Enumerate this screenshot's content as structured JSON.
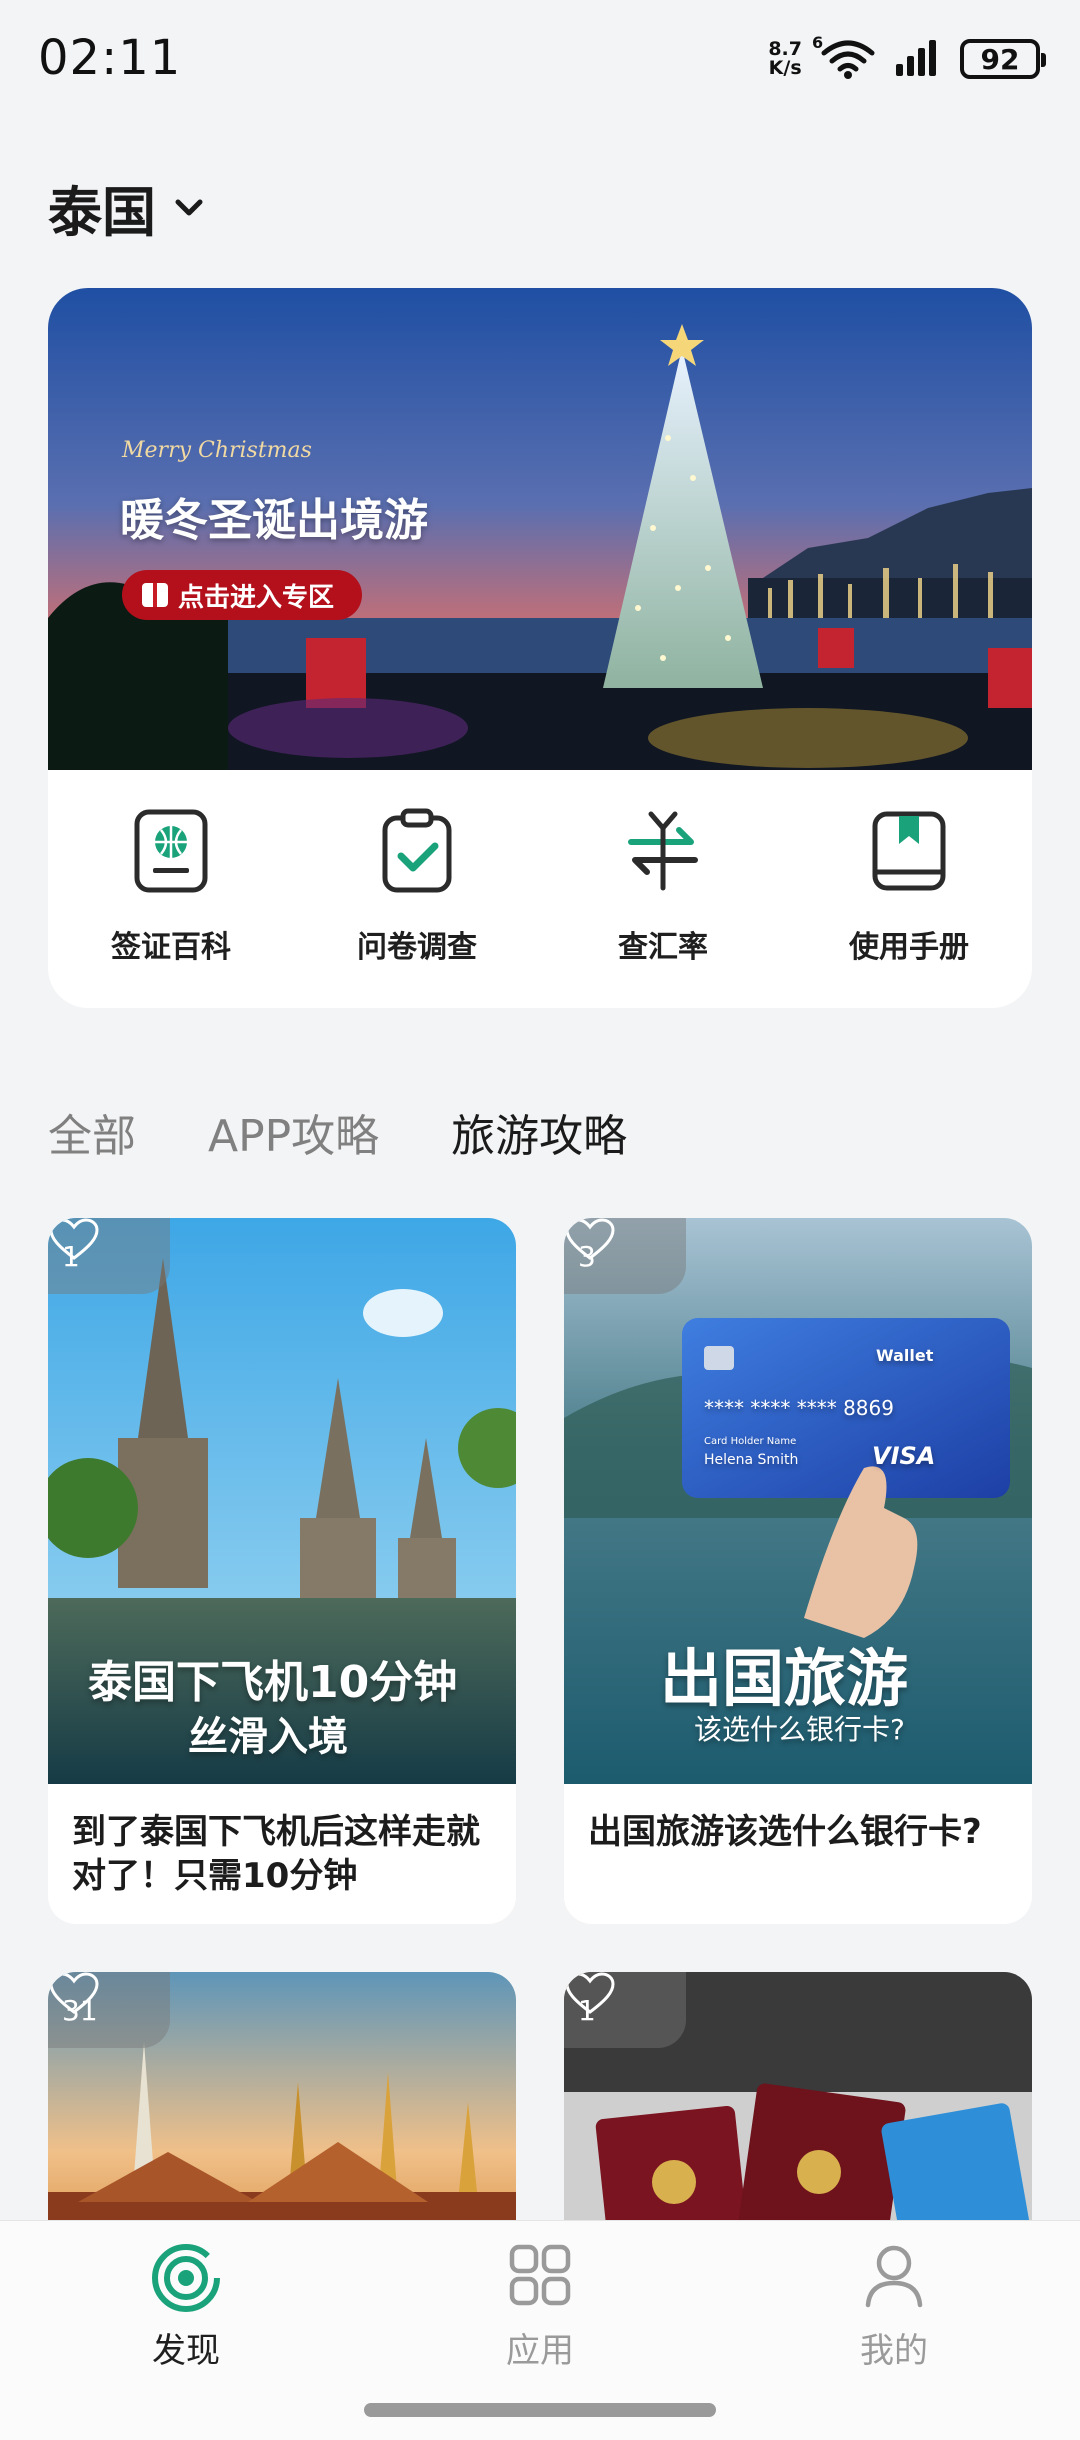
{
  "status_bar": {
    "time": "02:11",
    "net_speed_value": "8.7",
    "net_speed_unit": "K/s",
    "wifi_badge": "6",
    "battery": "92"
  },
  "header": {
    "title": "泰国",
    "dropdown_icon": "chevron-down-icon"
  },
  "banner": {
    "script_text": "Merry Christmas",
    "headline": "暖冬圣诞出境游",
    "button_label": "点击进入专区"
  },
  "quick_actions": [
    {
      "label": "签证百科",
      "icon": "passport-globe-icon"
    },
    {
      "label": "问卷调查",
      "icon": "clipboard-check-icon"
    },
    {
      "label": "查汇率",
      "icon": "exchange-rate-icon"
    },
    {
      "label": "使用手册",
      "icon": "bookmark-book-icon"
    }
  ],
  "tabs": [
    {
      "label": "全部",
      "active": false
    },
    {
      "label": "APP攻略",
      "active": false
    },
    {
      "label": "旅游攻略",
      "active": true
    }
  ],
  "cards": [
    {
      "likes": "1",
      "title": "到了泰国下飞机后这样走就对了！只需10分钟",
      "overlay_line1": "泰国下飞机10分钟",
      "overlay_line2": "丝滑入境"
    },
    {
      "likes": "3",
      "title": "出国旅游该选什么银行卡?",
      "overlay_line1": "出国旅游",
      "overlay_line2": "该选什么银行卡?",
      "card_brand": "Wallet",
      "card_number": "**** **** **** 8869",
      "card_holder_label": "Card Holder Name",
      "card_holder": "Helena Smith",
      "card_network": "VISA"
    },
    {
      "likes": "31"
    },
    {
      "likes": "1"
    }
  ],
  "bottom_nav": [
    {
      "label": "发现",
      "icon": "discover-icon",
      "active": true
    },
    {
      "label": "应用",
      "icon": "apps-grid-icon",
      "active": false
    },
    {
      "label": "我的",
      "icon": "profile-icon",
      "active": false
    }
  ],
  "colors": {
    "accent_green": "#1aa37a",
    "banner_button": "#b3101c",
    "inactive_gray": "#9a9a9a"
  }
}
